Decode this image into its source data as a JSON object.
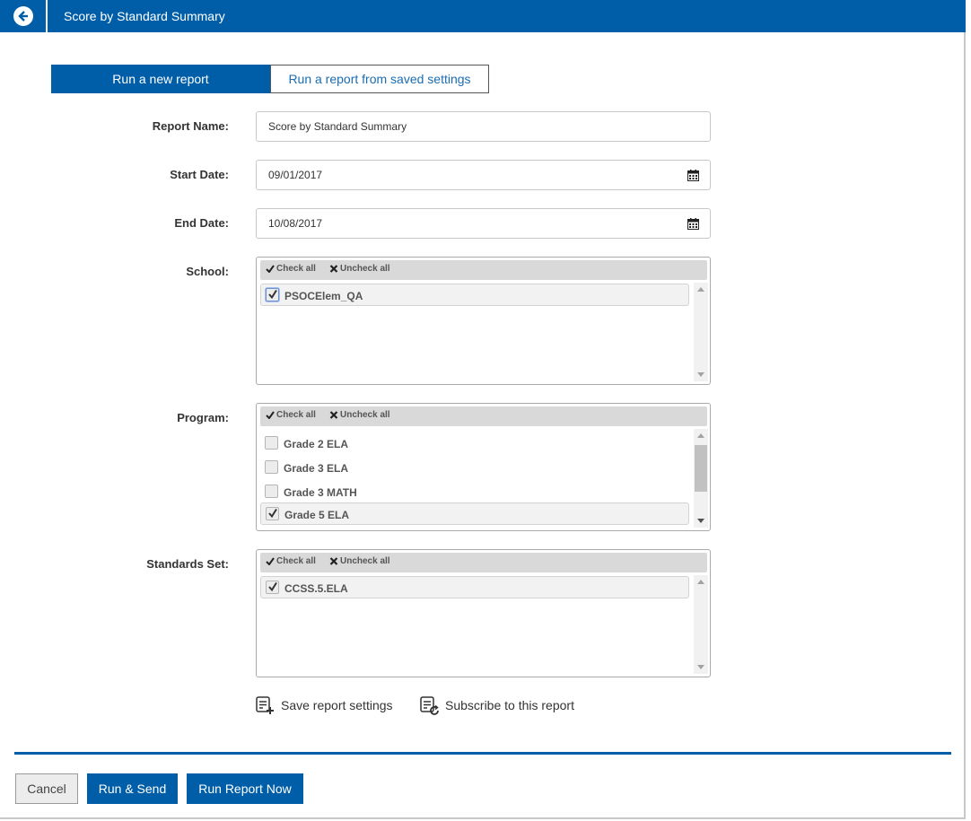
{
  "header": {
    "title": "Score by Standard Summary",
    "back_icon": "arrow-circle-left-icon"
  },
  "tabs": {
    "new_report": "Run a new report",
    "saved_settings": "Run a report from saved settings"
  },
  "form": {
    "report_name_label": "Report Name:",
    "report_name_value": "Score by Standard Summary",
    "start_date_label": "Start Date:",
    "start_date_value": "09/01/2017",
    "end_date_label": "End Date:",
    "end_date_value": "10/08/2017",
    "school_label": "School:",
    "program_label": "Program:",
    "standards_label": "Standards Set:"
  },
  "list_toolbar": {
    "check_all": "Check all",
    "uncheck_all": "Uncheck all"
  },
  "school_items": [
    {
      "label": "PSOCElem_QA",
      "checked": true
    }
  ],
  "program_items": [
    {
      "label": "Grade 2 ELA",
      "checked": false
    },
    {
      "label": "Grade 3 ELA",
      "checked": false
    },
    {
      "label": "Grade 3 MATH",
      "checked": false
    },
    {
      "label": "Grade 5 ELA",
      "checked": true
    }
  ],
  "standards_items": [
    {
      "label": "CCSS.5.ELA",
      "checked": true
    }
  ],
  "actions": {
    "save_settings": "Save report settings",
    "subscribe": "Subscribe to this report"
  },
  "footer": {
    "cancel": "Cancel",
    "run_send": "Run & Send",
    "run_now": "Run Report Now"
  },
  "colors": {
    "brand": "#005ea8",
    "link": "#1a6db3"
  }
}
